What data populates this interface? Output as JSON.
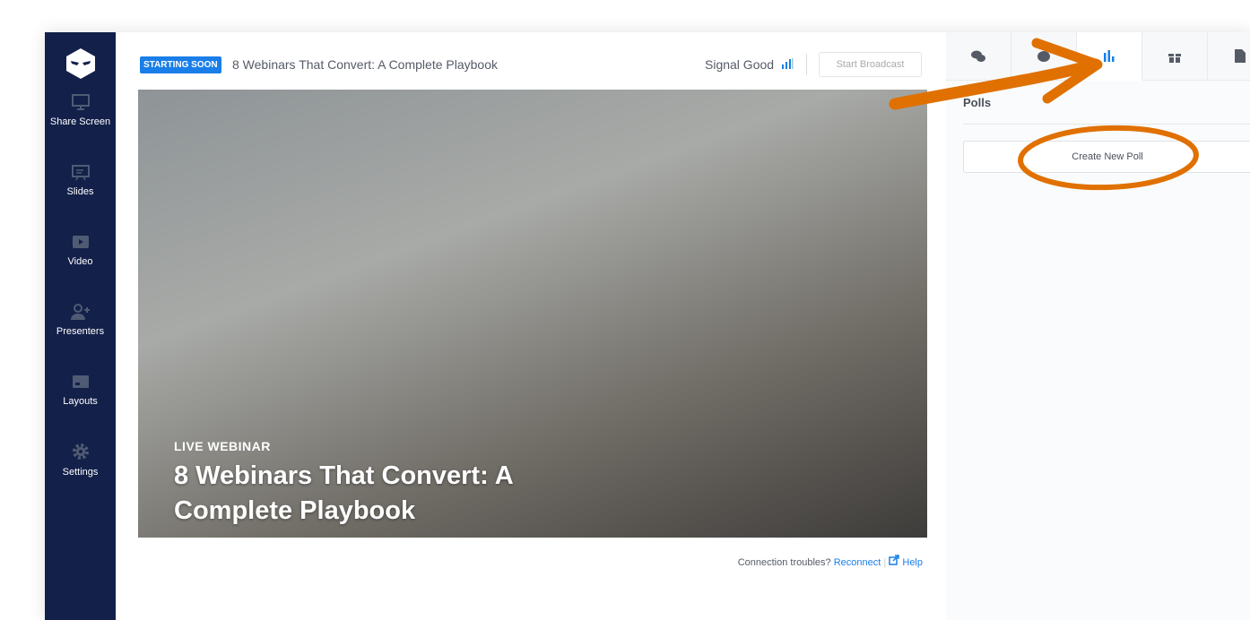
{
  "sidebar": {
    "items": [
      {
        "label": "Share Screen",
        "icon": "share-screen-icon"
      },
      {
        "label": "Slides",
        "icon": "slides-icon"
      },
      {
        "label": "Video",
        "icon": "video-icon"
      },
      {
        "label": "Presenters",
        "icon": "add-presenter-icon"
      },
      {
        "label": "Layouts",
        "icon": "layout-icon"
      },
      {
        "label": "Settings",
        "icon": "gear-icon"
      }
    ]
  },
  "header": {
    "status_badge": "STARTING SOON",
    "title": "8 Webinars That Convert: A Complete Playbook",
    "signal": "Signal Good",
    "start_button": "Start Broadcast"
  },
  "video": {
    "label": "LIVE WEBINAR",
    "title": "8 Webinars That Convert: A Complete Playbook"
  },
  "footer": {
    "prefix": "Connection troubles?",
    "reconnect": "Reconnect",
    "help": "Help"
  },
  "panel": {
    "tabs": [
      {
        "icon": "chat-icon"
      },
      {
        "icon": "questions-icon"
      },
      {
        "icon": "polls-icon",
        "active": true
      },
      {
        "icon": "gift-icon"
      },
      {
        "icon": "document-icon"
      }
    ],
    "title": "Polls",
    "create_button": "Create New Poll"
  },
  "colors": {
    "sidebar": "#13204a",
    "accent": "#1a7ee8",
    "annotation": "#e07000"
  }
}
